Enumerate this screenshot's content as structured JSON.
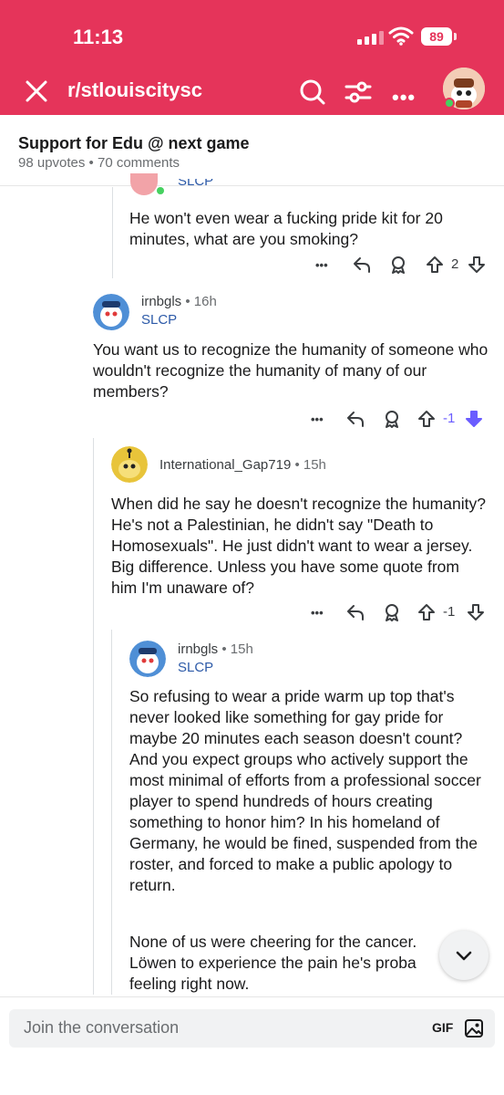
{
  "status_bar": {
    "time": "11:13",
    "battery": "89"
  },
  "header": {
    "subreddit": "r/stlouiscitysc"
  },
  "post": {
    "title": "Support for Edu @ next game",
    "meta": "98 upvotes • 70 comments"
  },
  "comments": [
    {
      "flair": "SLCP",
      "body": "He won't even wear a fucking pride kit for 20 minutes, what are you smoking?",
      "votes": "2"
    },
    {
      "username": "irnbgls",
      "age": "16h",
      "flair": "SLCP",
      "body": "You want us to recognize the humanity of someone who wouldn't recognize the humanity of many of our members?",
      "votes": "-1"
    },
    {
      "username": "International_Gap719",
      "age": "15h",
      "body": "When did he say he doesn't recognize the humanity?  He's not a Palestinian, he didn't say \"Death to Homosexuals\".  He just didn't want to wear a jersey.  Big difference.  Unless you have some quote from him I'm unaware of?",
      "votes": "-1"
    },
    {
      "username": "irnbgls",
      "age": "15h",
      "flair": "SLCP",
      "body": "So refusing to wear a pride warm up top that's never looked like something for gay pride for maybe 20 minutes each season doesn't count? And you expect groups who actively support the most minimal of efforts from a professional soccer player to spend hundreds of hours creating something to honor him? In his homeland of Germany, he would be fined, suspended from the roster, and forced to make a public apology to return.",
      "body2": "None of us were cheering for the cancer. Löwen to experience the pain he's proba feeling right now."
    }
  ],
  "composer": {
    "placeholder": "Join the conversation",
    "gif_label": "GIF"
  },
  "colors": {
    "header": "#e5345a",
    "flair": "#2d5aa8",
    "downvote_active": "#6a5cff"
  },
  "icons": [
    "close-icon",
    "search-icon",
    "filter-icon",
    "more-icon",
    "reply-icon",
    "award-icon",
    "upvote-icon",
    "downvote-icon",
    "chevron-down-icon",
    "image-icon"
  ]
}
